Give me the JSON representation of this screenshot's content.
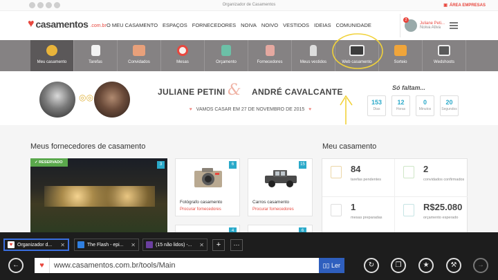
{
  "topbar": {
    "center_text": "Organizador de Casamentos",
    "area_empresas": "ÁREA EMPRESAS"
  },
  "brand": {
    "name": "casamentos",
    "tld": ".com.br"
  },
  "mainnav": [
    "O MEU CASAMENTO",
    "ESPAÇOS",
    "FORNECEDORES",
    "NOIVA",
    "NOIVO",
    "VESTIDOS",
    "IDEIAS",
    "COMUNIDADE"
  ],
  "user": {
    "name": "Juliane Peti...",
    "role": "Noiva Ativa",
    "notifications": "2"
  },
  "tools": [
    {
      "label": "Meu casamento",
      "icon": "rings-icon",
      "color": "#e9b43a"
    },
    {
      "label": "Tarefas",
      "icon": "clipboard-icon",
      "color": "#f3f3f3"
    },
    {
      "label": "Convidados",
      "icon": "guests-icon",
      "color": "#e8a07a"
    },
    {
      "label": "Mesas",
      "icon": "table-icon",
      "color": "#e8473e"
    },
    {
      "label": "Orçamento",
      "icon": "calculator-icon",
      "color": "#6cc0a7"
    },
    {
      "label": "Fornecedores",
      "icon": "notebook-icon",
      "color": "#e5a8a0"
    },
    {
      "label": "Meus vestidos",
      "icon": "dress-icon",
      "color": "#dddddd"
    },
    {
      "label": "Web casamento",
      "icon": "website-icon",
      "color": "#3c3c3c"
    },
    {
      "label": "Sorteio",
      "icon": "gift-icon",
      "color": "#f0a53a"
    },
    {
      "label": "Wedshoots",
      "icon": "camera-icon",
      "color": "#5a5a5a"
    }
  ],
  "couple": {
    "bride": "JULIANE PETINI",
    "amp": "&",
    "groom": "ANDRÉ CAVALCANTE",
    "date_text": "VAMOS CASAR EM 27 DE NOVEMBRO DE 2015",
    "so_faltam": "Só faltam...",
    "countdown": [
      {
        "value": "153",
        "unit": "Dias"
      },
      {
        "value": "12",
        "unit": "Horas"
      },
      {
        "value": "0",
        "unit": "Minutos"
      },
      {
        "value": "20",
        "unit": "Segundos"
      }
    ]
  },
  "suppliers": {
    "title": "Meus fornecedores de casamento",
    "reserved_label": "RESERVADO",
    "venue_count": "3",
    "cards": [
      {
        "title": "Fotógrafo casamento",
        "link": "Procurar fornecedores",
        "count": "6"
      },
      {
        "title": "Carros casamento",
        "link": "Procurar fornecedores",
        "count": "15"
      }
    ],
    "next_counts": [
      "4",
      "6"
    ]
  },
  "summary": {
    "title": "Meu casamento",
    "stats": [
      {
        "value": "84",
        "desc": "tarefas pendentes"
      },
      {
        "value": "2",
        "desc": "convidados confirmados"
      },
      {
        "value": "1",
        "desc": "mesas preparadas"
      },
      {
        "value": "R$25.080",
        "desc": "orçamento esperado"
      }
    ]
  },
  "browser": {
    "tabs": [
      {
        "label": "Organizador d...",
        "color": "#e8473e"
      },
      {
        "label": "The Flash - epi...",
        "color": "#2f7fe0"
      },
      {
        "label": "(15 não lidos) -...",
        "color": "#6b3fa0"
      }
    ],
    "url": "www.casamentos.com.br/tools/Main",
    "read_label": "Ler"
  }
}
